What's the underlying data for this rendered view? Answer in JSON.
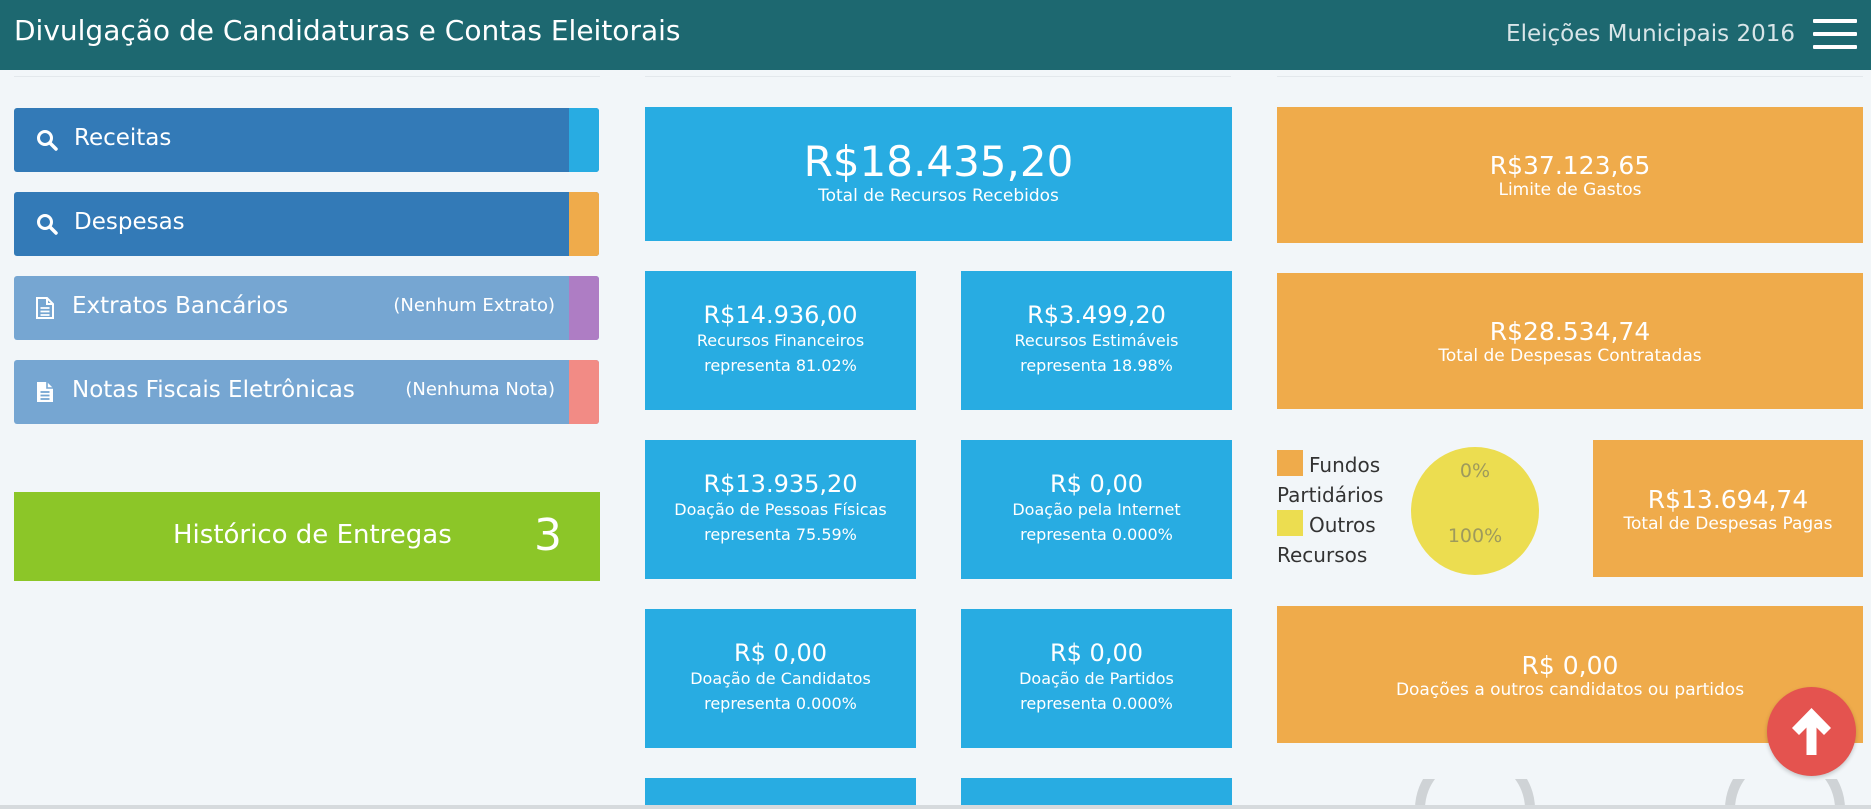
{
  "header": {
    "title": "Divulgação de Candidaturas e Contas Eleitorais",
    "subtitle": "Eleições Municipais 2016"
  },
  "menu": [
    {
      "label": "Receitas",
      "note": "",
      "icon": "search-icon",
      "strip_color": "#28ace2"
    },
    {
      "label": "Despesas",
      "note": "",
      "icon": "search-icon",
      "strip_color": "#efab4b"
    },
    {
      "label": "Extratos Bancários",
      "note": "(Nenhum Extrato)",
      "icon": "document-outline-icon",
      "strip_color": "#ae7dc4"
    },
    {
      "label": "Notas Fiscais Eletrônicas",
      "note": "(Nenhuma Nota)",
      "icon": "document-icon",
      "strip_color": "#f28b85"
    }
  ],
  "historico": {
    "label": "Histórico de Entregas",
    "count": "3"
  },
  "receitas": {
    "total": {
      "value": "R$18.435,20",
      "label": "Total de Recursos Recebidos"
    },
    "cards": [
      {
        "value": "R$14.936,00",
        "label": "Recursos Financeiros",
        "pct": "representa 81.02%"
      },
      {
        "value": "R$3.499,20",
        "label": "Recursos Estimáveis",
        "pct": "representa 18.98%"
      },
      {
        "value": "R$13.935,20",
        "label": "Doação de Pessoas Físicas",
        "pct": "representa 75.59%"
      },
      {
        "value": "R$ 0,00",
        "label": "Doação pela Internet",
        "pct": "representa 0.000%"
      },
      {
        "value": "R$ 0,00",
        "label": "Doação de Candidatos",
        "pct": "representa 0.000%"
      },
      {
        "value": "R$ 0,00",
        "label": "Doação de Partidos",
        "pct": "representa 0.000%"
      }
    ]
  },
  "despesas": {
    "limite": {
      "value": "R$37.123,65",
      "label": "Limite de Gastos"
    },
    "contratadas": {
      "value": "R$28.534,74",
      "label": "Total de Despesas Contratadas"
    },
    "pagas": {
      "value": "R$13.694,74",
      "label": "Total de Despesas Pagas"
    },
    "doacoes": {
      "value": "R$ 0,00",
      "label": "Doações a outros candidatos ou partidos"
    }
  },
  "legend": [
    {
      "label": "Fundos Partidários",
      "color": "#efab4b"
    },
    {
      "label": "Outros Recursos",
      "color": "#ecdd50"
    }
  ],
  "pie": {
    "slices": [
      {
        "name": "Fundos Partidários",
        "percent": 0,
        "label": "0%",
        "color": "#efab4b"
      },
      {
        "name": "Outros Recursos",
        "percent": 100,
        "label": "100%",
        "color": "#ecdd50"
      }
    ]
  },
  "colors": {
    "header": "#1d6870",
    "blue": "#28ace2",
    "orange": "#efab4b",
    "green": "#8cc628",
    "fab": "#e4534f"
  },
  "fab": {
    "icon": "arrow-up-icon"
  }
}
